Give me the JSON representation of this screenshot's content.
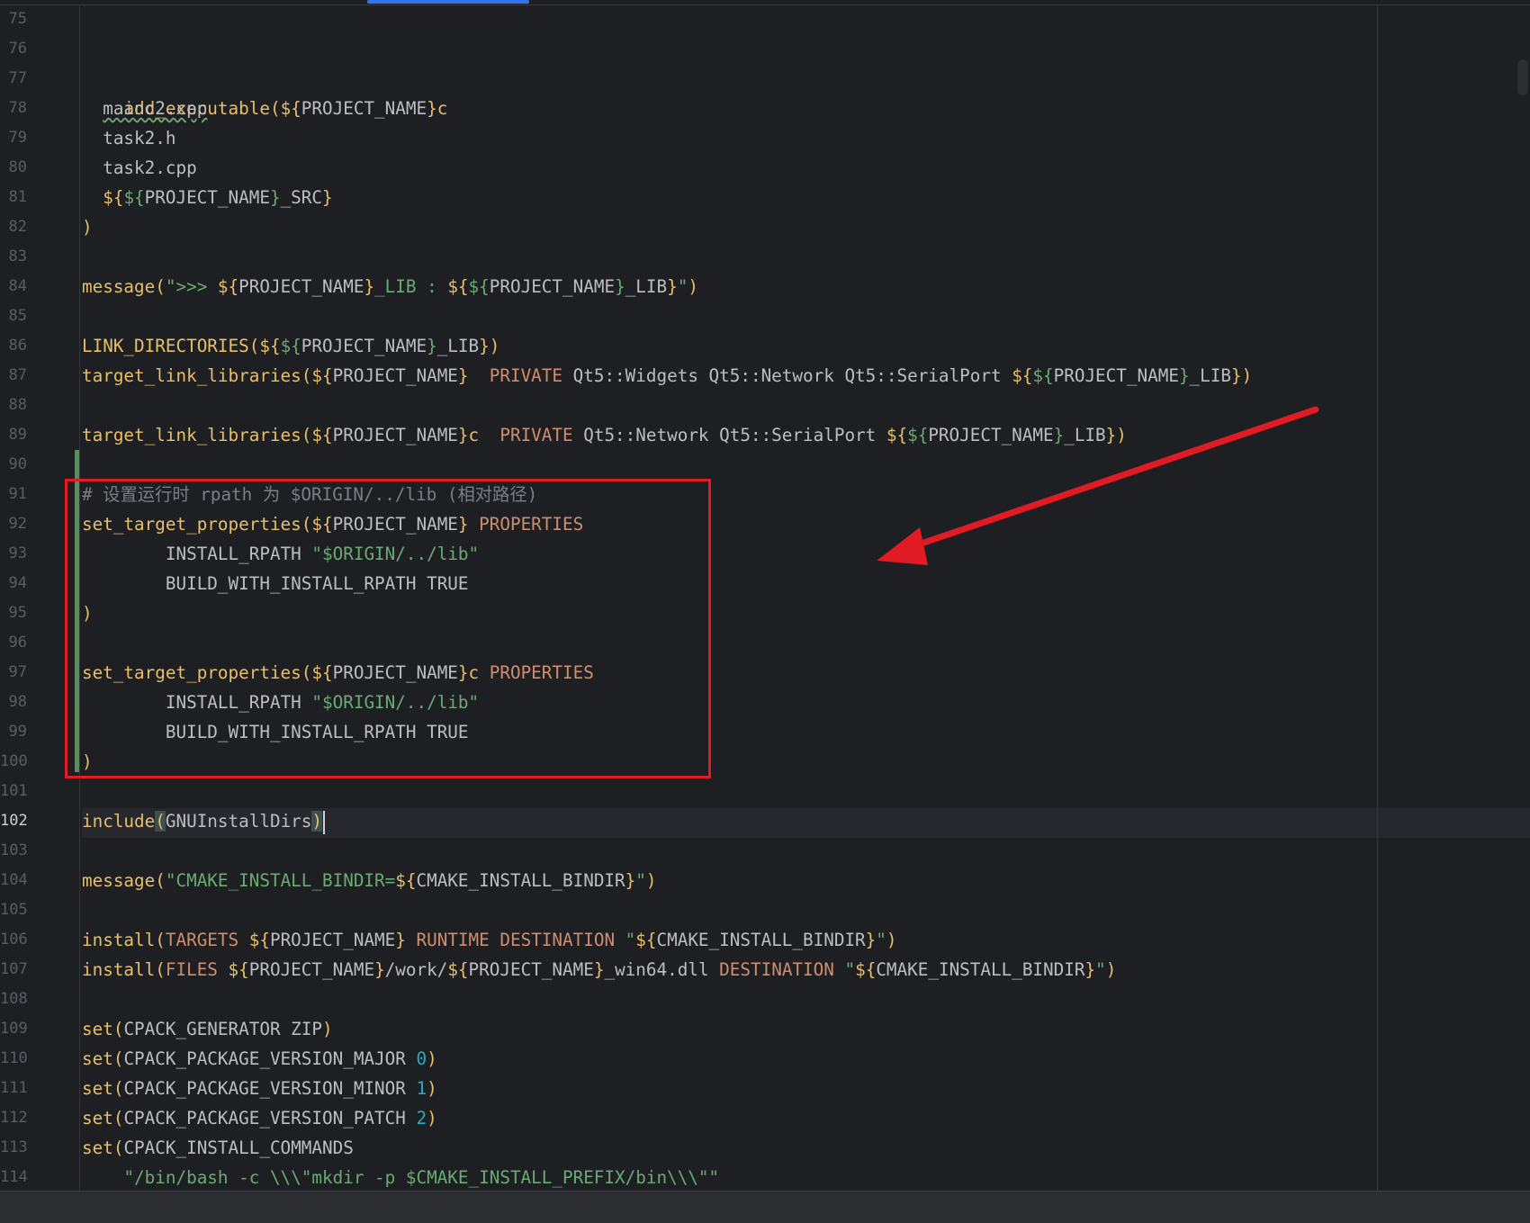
{
  "gutter": {
    "line_numbers": [
      "75",
      "76",
      "77",
      "78",
      "79",
      "80",
      "81",
      "82",
      "83",
      "84",
      "85",
      "86",
      "87",
      "88",
      "89",
      "90",
      "91",
      "92",
      "93",
      "94",
      "95",
      "96",
      "97",
      "98",
      "99",
      "100",
      "101",
      "102",
      "103",
      "104",
      "105",
      "106",
      "107",
      "108",
      "109",
      "110",
      "111",
      "112",
      "113",
      "114"
    ],
    "current_line": "102"
  },
  "colors": {
    "background": "#1e1f22",
    "function": "#e8bf6a",
    "keyword": "#cf8e6d",
    "string": "#6aab73",
    "number": "#2aacb8",
    "comment": "#7a7e85",
    "annotation_red": "#e01b24",
    "vcs_added": "#549159"
  },
  "code": {
    "l77": {
      "fn": "add_executable",
      "open": "(",
      "v1": "${",
      "v2": "PROJECT_NAME",
      "v3": "}c"
    },
    "l78": {
      "text": "mainc2.cpp"
    },
    "l79": {
      "text": "task2.h"
    },
    "l80": {
      "text": "task2.cpp"
    },
    "l81": {
      "a": "${",
      "b": "${",
      "c": "PROJECT_NAME",
      "d": "}",
      "e": "_SRC",
      "f": "}"
    },
    "l82": {
      "close": ")"
    },
    "l84": {
      "fn": "message",
      "open": "(",
      "s1": "\">>> ",
      "a": "${",
      "b": "PROJECT_NAME",
      "c": "}",
      "s2": "_LIB : ",
      "d": "${",
      "e": "${",
      "f": "PROJECT_NAME",
      "g": "}",
      "h": "_LIB",
      "i": "}",
      "s3": "\"",
      "close": ")"
    },
    "l86": {
      "fn": "LINK_DIRECTORIES",
      "open": "(",
      "a": "${",
      "b": "${",
      "c": "PROJECT_NAME",
      "d": "}",
      "e": "_LIB",
      "f": "}",
      "close": ")"
    },
    "l87": {
      "fn": "target_link_libraries",
      "open": "(",
      "a": "${",
      "b": "PROJECT_NAME",
      "c": "}",
      "sp": "  ",
      "kw": "PRIVATE",
      "libs": " Qt5::Widgets Qt5::Network Qt5::SerialPort ",
      "d": "${",
      "e": "${",
      "f": "PROJECT_NAME",
      "g": "}",
      "h": "_LIB",
      "i": "}",
      "close": ")"
    },
    "l89": {
      "fn": "target_link_libraries",
      "open": "(",
      "a": "${",
      "b": "PROJECT_NAME",
      "c": "}c",
      "sp": "  ",
      "kw": "PRIVATE",
      "libs": " Qt5::Network Qt5::SerialPort ",
      "d": "${",
      "e": "${",
      "f": "PROJECT_NAME",
      "g": "}",
      "h": "_LIB",
      "i": "}",
      "close": ")"
    },
    "l91": {
      "comment": "# 设置运行时 rpath 为 $ORIGIN/../lib (相对路径)"
    },
    "l92": {
      "fn": "set_target_properties",
      "open": "(",
      "a": "${",
      "b": "PROJECT_NAME",
      "c": "}",
      "kw": " PROPERTIES"
    },
    "l93": {
      "prop": "INSTALL_RPATH ",
      "str": "\"$ORIGIN/../lib\""
    },
    "l94": {
      "prop": "BUILD_WITH_INSTALL_RPATH TRUE"
    },
    "l95": {
      "close": ")"
    },
    "l97": {
      "fn": "set_target_properties",
      "open": "(",
      "a": "${",
      "b": "PROJECT_NAME",
      "c": "}c",
      "kw": " PROPERTIES"
    },
    "l98": {
      "prop": "INSTALL_RPATH ",
      "str": "\"$ORIGIN/../lib\""
    },
    "l99": {
      "prop": "BUILD_WITH_INSTALL_RPATH TRUE"
    },
    "l100": {
      "close": ")"
    },
    "l102": {
      "fn": "include",
      "open": "(",
      "arg": "GNUInstallDirs",
      "close": ")"
    },
    "l104": {
      "fn": "message",
      "open": "(",
      "s1": "\"CMAKE_INSTALL_BINDIR=",
      "a": "${",
      "b": "CMAKE_INSTALL_BINDIR",
      "c": "}",
      "s2": "\"",
      "close": ")"
    },
    "l106": {
      "fn": "install",
      "open": "(",
      "kw1": "TARGETS ",
      "a": "${",
      "b": "PROJECT_NAME",
      "c": "}",
      "kw2": " RUNTIME DESTINATION ",
      "s1": "\"",
      "d": "${",
      "e": "CMAKE_INSTALL_BINDIR",
      "f": "}",
      "s2": "\"",
      "close": ")"
    },
    "l107": {
      "fn": "install",
      "open": "(",
      "kw1": "FILES ",
      "a": "${",
      "b": "PROJECT_NAME",
      "c": "}",
      "mid": "/work/",
      "d": "${",
      "e": "PROJECT_NAME",
      "f": "}",
      "g": "_win64.dll",
      "kw2": " DESTINATION ",
      "s1": "\"",
      "h": "${",
      "i": "CMAKE_INSTALL_BINDIR",
      "j": "}",
      "s2": "\"",
      "close": ")"
    },
    "l109": {
      "fn": "set",
      "open": "(",
      "arg": "CPACK_GENERATOR ZIP",
      "close": ")"
    },
    "l110": {
      "fn": "set",
      "open": "(",
      "arg": "CPACK_PACKAGE_VERSION_MAJOR ",
      "num": "0",
      "close": ")"
    },
    "l111": {
      "fn": "set",
      "open": "(",
      "arg": "CPACK_PACKAGE_VERSION_MINOR ",
      "num": "1",
      "close": ")"
    },
    "l112": {
      "fn": "set",
      "open": "(",
      "arg": "CPACK_PACKAGE_VERSION_PATCH ",
      "num": "2",
      "close": ")"
    },
    "l113": {
      "fn": "set",
      "open": "(",
      "arg": "CPACK_INSTALL_COMMANDS"
    },
    "l114": {
      "str": "\"/bin/bash -c \\\\\\\"mkdir -p $CMAKE_INSTALL_PREFIX/bin\\\\\\\"\""
    }
  }
}
